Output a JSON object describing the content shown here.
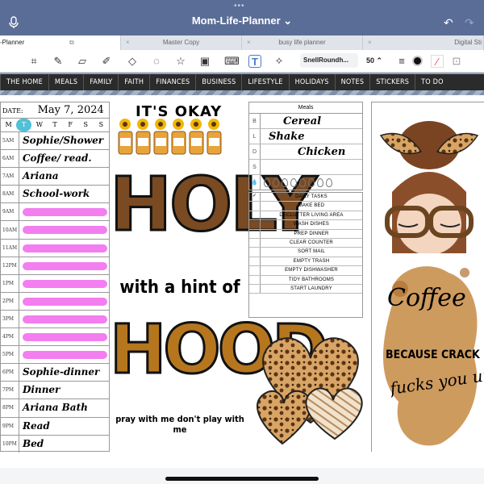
{
  "window": {
    "title": "Mom-Life-Planner ⌄",
    "dots": "•••"
  },
  "tabs": [
    "-Planner",
    "Master Copy",
    "busy life planner",
    "Digital Sti"
  ],
  "toolbar": {
    "font": "SnellRoundh...",
    "size": "50 ⌃",
    "icons": [
      "lasso-scan-icon",
      "pen-icon",
      "eraser-icon",
      "highlighter-icon",
      "shapes-icon",
      "lasso-icon",
      "sticker-icon",
      "image-icon",
      "keyboard-icon",
      "text-icon",
      "laser-icon"
    ]
  },
  "nav": [
    "THE HOME",
    "MEALS",
    "FAMILY",
    "FAITH",
    "FINANCES",
    "BUSINESS",
    "LIFESTYLE",
    "HOLIDAYS",
    "NOTES",
    "STICKERS",
    "TO DO"
  ],
  "schedule": {
    "date_label": "DATE:",
    "date": "May 7, 2024",
    "days": [
      "M",
      "T",
      "W",
      "T",
      "F",
      "S",
      "S"
    ],
    "rows": [
      {
        "hour": "5AM",
        "task": "Sophie/Shower"
      },
      {
        "hour": "6AM",
        "task": "Coffee/ read."
      },
      {
        "hour": "7AM",
        "task": "Ariana"
      },
      {
        "hour": "8AM",
        "task": "School-work"
      },
      {
        "hour": "9AM",
        "task": ""
      },
      {
        "hour": "10AM",
        "task": ""
      },
      {
        "hour": "11AM",
        "task": ""
      },
      {
        "hour": "12PM",
        "task": ""
      },
      {
        "hour": "1PM",
        "task": ""
      },
      {
        "hour": "2PM",
        "task": ""
      },
      {
        "hour": "3PM",
        "task": ""
      },
      {
        "hour": "4PM",
        "task": ""
      },
      {
        "hour": "5PM",
        "task": ""
      },
      {
        "hour": "6PM",
        "task": "Sophie-dinner"
      },
      {
        "hour": "7PM",
        "task": "Dinner"
      },
      {
        "hour": "8PM",
        "task": "Ariana Bath"
      },
      {
        "hour": "9PM",
        "task": "Read"
      },
      {
        "hour": "10PM",
        "task": "Bed"
      }
    ]
  },
  "meals": {
    "heading": "Meals",
    "rows": [
      {
        "letter": "B",
        "meal": "Cereal"
      },
      {
        "letter": "L",
        "meal": "Shake"
      },
      {
        "letter": "D",
        "meal": "Chicken"
      },
      {
        "letter": "S",
        "meal": ""
      }
    ]
  },
  "daily_tasks": {
    "heading": "DAILY TASKS",
    "items": [
      "MAKE BED",
      "DECLUTTER LIVING AREA",
      "WASH DISHES",
      "PREP DINNER",
      "CLEAR COUNTER",
      "SORT MAIL",
      "EMPTY TRASH",
      "EMPTY DISHWASHER",
      "TIDY BATHROOMS",
      "START LAUNDRY"
    ]
  },
  "stickers": {
    "its_okay": "IT'S OKAY",
    "holy_1": "HOLY",
    "holy_2": "with a hint of",
    "holy_3": "HOOD",
    "holy_4": "pray with me don't play with me",
    "coffee_1": "Coffee",
    "coffee_2": "BECAUSE CRACK",
    "coffee_3": "fucks you up"
  },
  "colors": {
    "highlight": "#f37ef0",
    "today": "#52c0d8",
    "titlebar": "#5a6d96"
  }
}
